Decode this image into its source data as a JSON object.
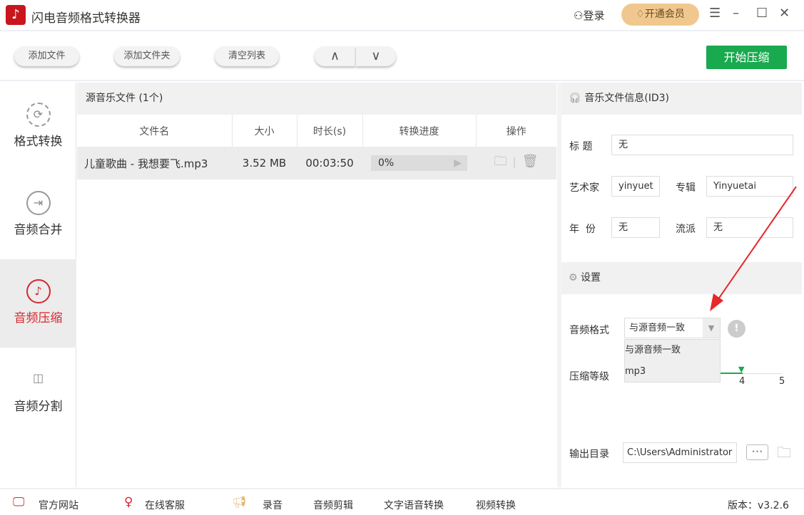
{
  "app": {
    "title": "闪电音频格式转换器",
    "login": "登录",
    "vip": "开通会员"
  },
  "toolbar": {
    "add_file": "添加文件",
    "add_folder": "添加文件夹",
    "clear_list": "清空列表",
    "start": "开始压缩"
  },
  "sidebar": {
    "items": [
      {
        "label": "格式转换"
      },
      {
        "label": "音频合并"
      },
      {
        "label": "音频压缩"
      },
      {
        "label": "音频分割"
      }
    ]
  },
  "filelist": {
    "title": "源音乐文件 (1个)",
    "columns": [
      "文件名",
      "大小",
      "时长(s)",
      "转换进度",
      "操作"
    ],
    "rows": [
      {
        "name": "儿童歌曲 - 我想要飞.mp3",
        "size": "3.52 MB",
        "duration": "00:03:50",
        "progress": "0%",
        "progress_value": 0
      }
    ]
  },
  "id3": {
    "title": "音乐文件信息(ID3)",
    "title_label": "标  题",
    "title_value": "无",
    "artist_label": "艺术家",
    "artist_value": "yinyuet",
    "album_label": "专辑",
    "album_value": "Yinyuetai",
    "year_label": "年  份",
    "year_value": "无",
    "genre_label": "流派",
    "genre_value": "无"
  },
  "settings": {
    "title": "设置",
    "format_label": "音频格式",
    "format_value": "与源音频一致",
    "format_options": [
      "与源音频一致",
      "mp3"
    ],
    "level_label": "压缩等级",
    "level_value": 4,
    "level_max": 5,
    "level_ticks": [
      "4",
      "5"
    ],
    "output_label": "输出目录",
    "output_value": "C:\\Users\\Administrator",
    "browse": "•••"
  },
  "footer": {
    "website": "官方网站",
    "service": "在线客服",
    "record": "录音",
    "cut": "音频剪辑",
    "tts": "文字语音转换",
    "video": "视频转换",
    "version": "版本：v3.2.6"
  },
  "colors": {
    "accent": "#19a94e",
    "brand": "#c8161d",
    "active": "#d9262c",
    "arrow": "#e8272a"
  }
}
